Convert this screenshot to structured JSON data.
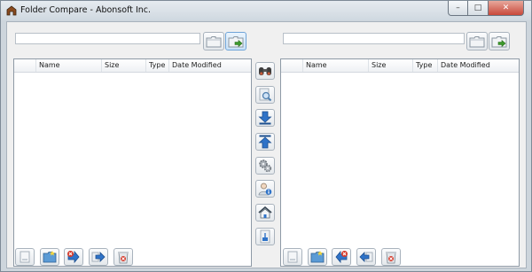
{
  "window": {
    "title": "Folder Compare - Abonsoft Inc.",
    "caption": {
      "minimize": "–",
      "maximize": "□",
      "close": "✕"
    }
  },
  "left_pane": {
    "path_value": "",
    "columns": [
      "",
      "Name",
      "Size",
      "Type",
      "Date Modified"
    ],
    "rows": []
  },
  "right_pane": {
    "path_value": "",
    "columns": [
      "",
      "Name",
      "Size",
      "Type",
      "Date Modified"
    ],
    "rows": []
  },
  "icons": {
    "browse": "folder-icon",
    "go": "folder-go-icon",
    "compare": "binoculars-icon",
    "find": "magnifier-icon",
    "download": "arrow-down-icon",
    "upload": "arrow-up-icon",
    "settings": "gears-icon",
    "about": "user-info-icon",
    "home": "home-icon",
    "exit": "exit-icon",
    "new": "new-doc-icon",
    "new_folder": "new-folder-icon",
    "delete_copy": "delete-copy-icon",
    "copy_right": "copy-right-icon",
    "copy_left": "copy-left-icon",
    "trash": "trash-icon"
  },
  "colors": {
    "accent": "#2f73c8",
    "green": "#3c9a2c",
    "red": "#d43a2c"
  }
}
